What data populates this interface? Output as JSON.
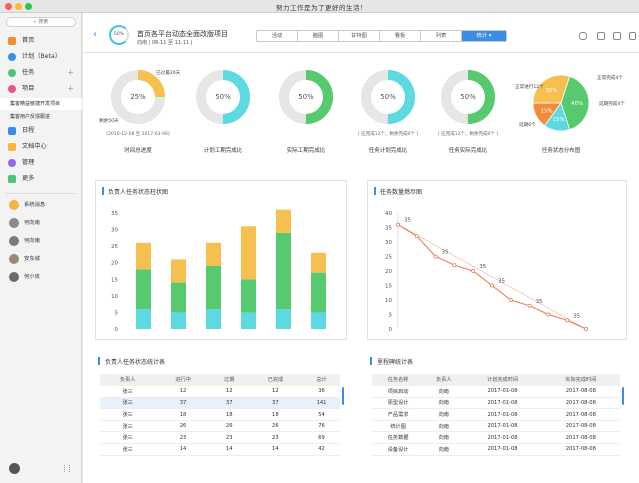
{
  "window": {
    "title": "努力工作是为了更好的生活!"
  },
  "sidebar": {
    "search_label": "搜索",
    "items": [
      {
        "label": "首页",
        "icon": "home-icon",
        "color": "#f08c3a"
      },
      {
        "label": "计划（Beta）",
        "icon": "plan-icon",
        "color": "#3a8ee6"
      },
      {
        "label": "任务",
        "icon": "task-icon",
        "color": "#4cc47a"
      },
      {
        "label": "项目",
        "icon": "project-icon",
        "color": "#e8558a"
      }
    ],
    "subitems": [
      "集客精益敏捷开发项目",
      "集客用户反馈跟进"
    ],
    "items2": [
      {
        "label": "日程",
        "icon": "calendar-icon",
        "color": "#3a8ee6"
      },
      {
        "label": "文档中心",
        "icon": "docs-icon",
        "color": "#f5b53e"
      },
      {
        "label": "管理",
        "icon": "manage-icon",
        "color": "#8f6be8"
      },
      {
        "label": "更多",
        "icon": "more-icon",
        "color": "#4cc47a"
      }
    ],
    "contacts": [
      "系统消息",
      "何向南",
      "何向南",
      "安东城",
      "何小攻"
    ]
  },
  "header": {
    "progress": "50%",
    "title": "首页各平台动态全面改版项目",
    "subtitle": "向南 | 08-11 至 11-11 |",
    "tabs": [
      "活动",
      "脑图",
      "甘特图",
      "看板",
      "列表",
      "统计 ▾"
    ]
  },
  "donuts": [
    {
      "label": "时间总进度",
      "value": "25%",
      "fill": 0.25,
      "color": "#f5c04f",
      "sub": "[2016-12-08 至 2017-03-06]",
      "ann1": "已过最20天",
      "ann2": "剩余50天"
    },
    {
      "label": "计划工期完成比",
      "value": "50%",
      "fill": 0.5,
      "color": "#5dd9e0",
      "sub": ""
    },
    {
      "label": "实际工期完成比",
      "value": "50%",
      "fill": 0.5,
      "color": "#57c96e",
      "sub": ""
    },
    {
      "label": "任务计划完成比",
      "value": "50%",
      "fill": 0.5,
      "color": "#5dd9e0",
      "sub": "[ 应完成12个，剩余完成6个 ]"
    },
    {
      "label": "任务实际完成比",
      "value": "50%",
      "fill": 0.5,
      "color": "#57c96e",
      "sub": "[ 应完成12个，剩余完成6个 ]"
    }
  ],
  "pie": {
    "label": "任务状态分布图",
    "slices": [
      {
        "name": "正常进行12个",
        "value": 40,
        "color": "#57c96e"
      },
      {
        "name": "正常完成4个",
        "value": 15,
        "color": "#5dd9e0"
      },
      {
        "name": "延期完成4个",
        "value": 15,
        "color": "#f08c3a"
      },
      {
        "name": "延期6个",
        "value": 30,
        "color": "#f5c04f"
      }
    ],
    "pct_labels": [
      "40%",
      "15%",
      "15%",
      "30%"
    ]
  },
  "bar_panel": {
    "title": "负责人任务状态柱状图"
  },
  "line_panel": {
    "title": "任务数量燃尽图"
  },
  "chart_data": [
    {
      "type": "bar",
      "stacked": true,
      "ylim": [
        0,
        35
      ],
      "yticks": [
        "0",
        "5",
        "10",
        "15",
        "20",
        "25",
        "30",
        "35"
      ],
      "categories": [
        "",
        "",
        "",
        "",
        "",
        ""
      ],
      "series": [
        {
          "values": [
            6,
            5,
            6,
            5,
            6,
            5
          ],
          "color": "#5dd9e0"
        },
        {
          "values": [
            12,
            9,
            13,
            10,
            23,
            12
          ],
          "color": "#57c96e"
        },
        {
          "values": [
            8,
            7,
            7,
            16,
            7,
            6
          ],
          "color": "#f5c04f"
        }
      ]
    },
    {
      "type": "line",
      "ylim": [
        0,
        40
      ],
      "yticks": [
        "0",
        "5",
        "10",
        "15",
        "20",
        "25",
        "30",
        "35",
        "40"
      ],
      "labels": [
        "35",
        "35",
        "35",
        "35",
        "35",
        "35"
      ],
      "actual": [
        36,
        32,
        25,
        22,
        20,
        15,
        10,
        8,
        5,
        3,
        0
      ],
      "ideal": [
        36,
        0
      ]
    }
  ],
  "table1": {
    "title": "负责人任务状态统计表",
    "headers": [
      "负责人",
      "进行中",
      "过期",
      "已完成",
      "总计"
    ],
    "rows": [
      [
        "张三",
        "12",
        "12",
        "12",
        "36"
      ],
      [
        "张三",
        "37",
        "37",
        "37",
        "141"
      ],
      [
        "张三",
        "18",
        "18",
        "18",
        "54"
      ],
      [
        "张三",
        "26",
        "26",
        "26",
        "76"
      ],
      [
        "张三",
        "23",
        "23",
        "23",
        "69"
      ],
      [
        "张三",
        "14",
        "14",
        "14",
        "42"
      ]
    ]
  },
  "table2": {
    "title": "里程碑统计表",
    "headers": [
      "任务名称",
      "负责人",
      "计划完成时间",
      "实际完成时间"
    ],
    "rows": [
      [
        "项目启动",
        "向南",
        "2017-01-08",
        "2017-08-08"
      ],
      [
        "原型设计",
        "向南",
        "2017-01-08",
        "2017-08-08"
      ],
      [
        "产品需求",
        "向南",
        "2017-01-08",
        "2017-08-08"
      ],
      [
        "统计图",
        "向南",
        "2017-01-08",
        "2017-08-08"
      ],
      [
        "任务数据",
        "向南",
        "2017-01-08",
        "2017-08-08"
      ],
      [
        "设备设计",
        "向南",
        "2017-01-08",
        "2017-08-08"
      ]
    ]
  }
}
